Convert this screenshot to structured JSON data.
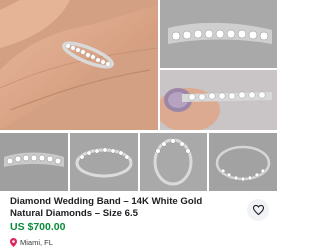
{
  "listing": {
    "title": "Diamond Wedding Band – 14K White Gold\nNatural Diamonds – Size 6.5",
    "price": "US $700.00",
    "location": "Miami, FL"
  },
  "icons": {
    "save": "heart-icon",
    "location": "map-pin-icon"
  },
  "colors": {
    "price": "#0a8a3a",
    "location_pin": "#e0245e"
  }
}
